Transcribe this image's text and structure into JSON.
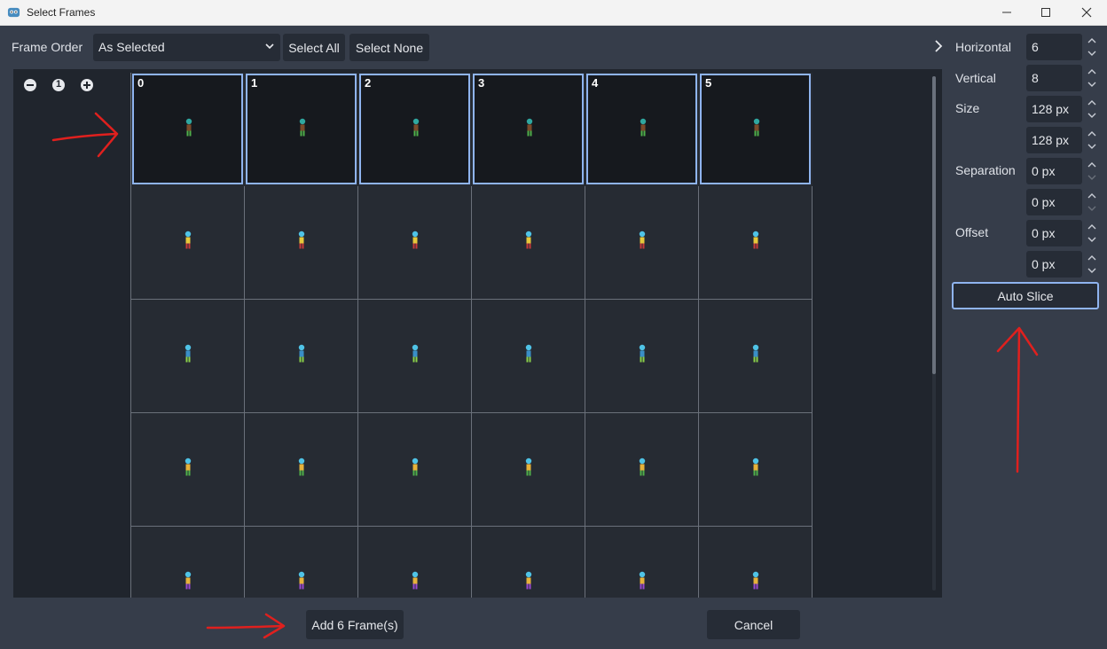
{
  "window": {
    "title": "Select Frames"
  },
  "toolbar": {
    "frame_order_label": "Frame Order",
    "frame_order_value": "As Selected",
    "select_all_label": "Select All",
    "select_none_label": "Select None"
  },
  "zoom": {
    "zoom_out": "zoom-out-icon",
    "zoom_reset_label": "1",
    "zoom_in": "zoom-in-icon"
  },
  "grid": {
    "columns": 6,
    "visible_rows": 5,
    "selected_frames": [
      "0",
      "1",
      "2",
      "3",
      "4",
      "5"
    ]
  },
  "settings": {
    "horizontal_label": "Horizontal",
    "horizontal_value": "6",
    "vertical_label": "Vertical",
    "vertical_value": "8",
    "size_label": "Size",
    "size_x_value": "128 px",
    "size_y_value": "128 px",
    "separation_label": "Separation",
    "separation_x_value": "0 px",
    "separation_y_value": "0 px",
    "offset_label": "Offset",
    "offset_x_value": "0 px",
    "offset_y_value": "0 px",
    "auto_slice_label": "Auto Slice",
    "collapse_glyph": "❯"
  },
  "footer": {
    "add_frames_label": "Add 6 Frame(s)",
    "cancel_label": "Cancel"
  },
  "colors": {
    "selection_border": "#8fb4ef",
    "annotation_red": "#e0201e",
    "panel_bg": "#363d4a"
  }
}
